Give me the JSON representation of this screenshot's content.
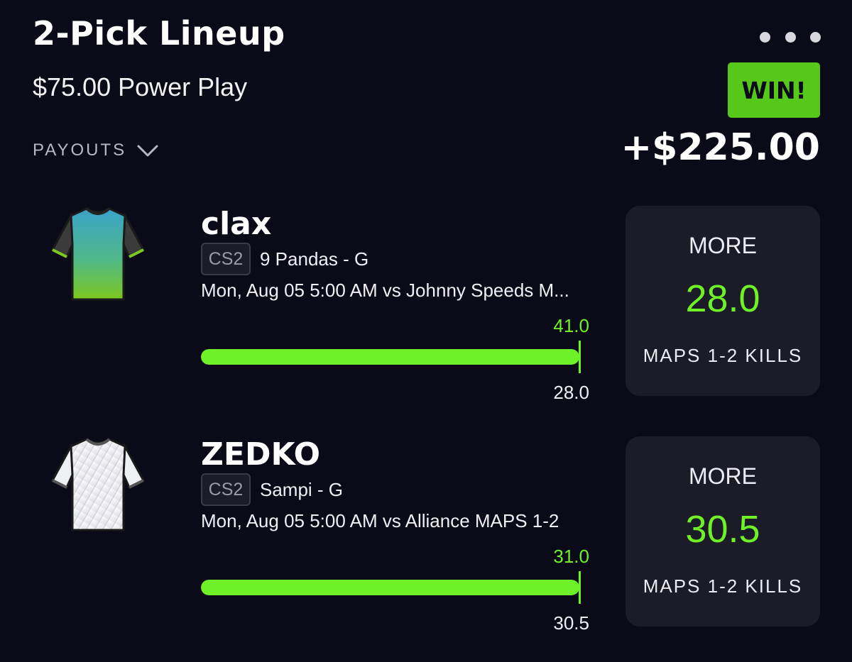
{
  "header": {
    "title": "2-Pick Lineup",
    "subtitle": "$75.00 Power Play",
    "menu_icon": "more-dots-icon",
    "result_badge": "WIN!",
    "payouts_label": "PAYOUTS",
    "payouts_icon": "chevron-down-icon",
    "payout_amount": "+$225.00"
  },
  "colors": {
    "background": "#0a0a18",
    "accent_green": "#6ef227",
    "win_badge": "#55c81a",
    "card_bg": "#1c1c28"
  },
  "picks": [
    {
      "player": "clax",
      "jersey_icon": "jersey-teal-green-icon",
      "game_tag": "CS2",
      "team": "9 Pandas - G",
      "match": "Mon, Aug 05 5:00 AM  vs Johnny Speeds M...",
      "actual": "41.0",
      "line": "28.0",
      "progress_fraction": 1.0,
      "direction": "MORE",
      "stat": "MAPS 1-2 KILLS"
    },
    {
      "player": "ZEDKO",
      "jersey_icon": "jersey-white-icon",
      "game_tag": "CS2",
      "team": "Sampi - G",
      "match": "Mon, Aug 05 5:00 AM  vs Alliance MAPS 1-2",
      "actual": "31.0",
      "line": "30.5",
      "progress_fraction": 1.0,
      "direction": "MORE",
      "stat": "MAPS 1-2 KILLS"
    }
  ]
}
